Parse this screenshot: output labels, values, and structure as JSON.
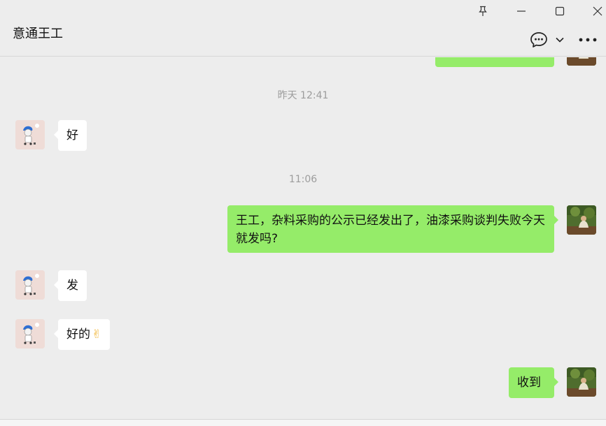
{
  "window": {
    "pin_icon": "pin-icon",
    "minimize_icon": "minimize-icon",
    "maximize_icon": "maximize-icon",
    "close_icon": "close-icon"
  },
  "header": {
    "title": "意通王工",
    "chat_icon": "speech-bubble-icon",
    "dropdown_icon": "chevron-down-icon",
    "more_icon": "more-horizontal-icon"
  },
  "colors": {
    "background": "#ededed",
    "outgoing_bubble": "#95ec69",
    "incoming_bubble": "#ffffff",
    "timestamp": "#9c9c9c"
  },
  "timestamps": [
    "昨天 12:41",
    "11:06"
  ],
  "messages": [
    {
      "side": "left",
      "text": "好"
    },
    {
      "side": "right",
      "text": "王工，杂料采购的公示已经发出了，油漆采购谈判失败今天就发吗?"
    },
    {
      "side": "left",
      "text": "发"
    },
    {
      "side": "left",
      "text": "好的",
      "emoji": "✌"
    },
    {
      "side": "right",
      "text": "收到"
    }
  ]
}
